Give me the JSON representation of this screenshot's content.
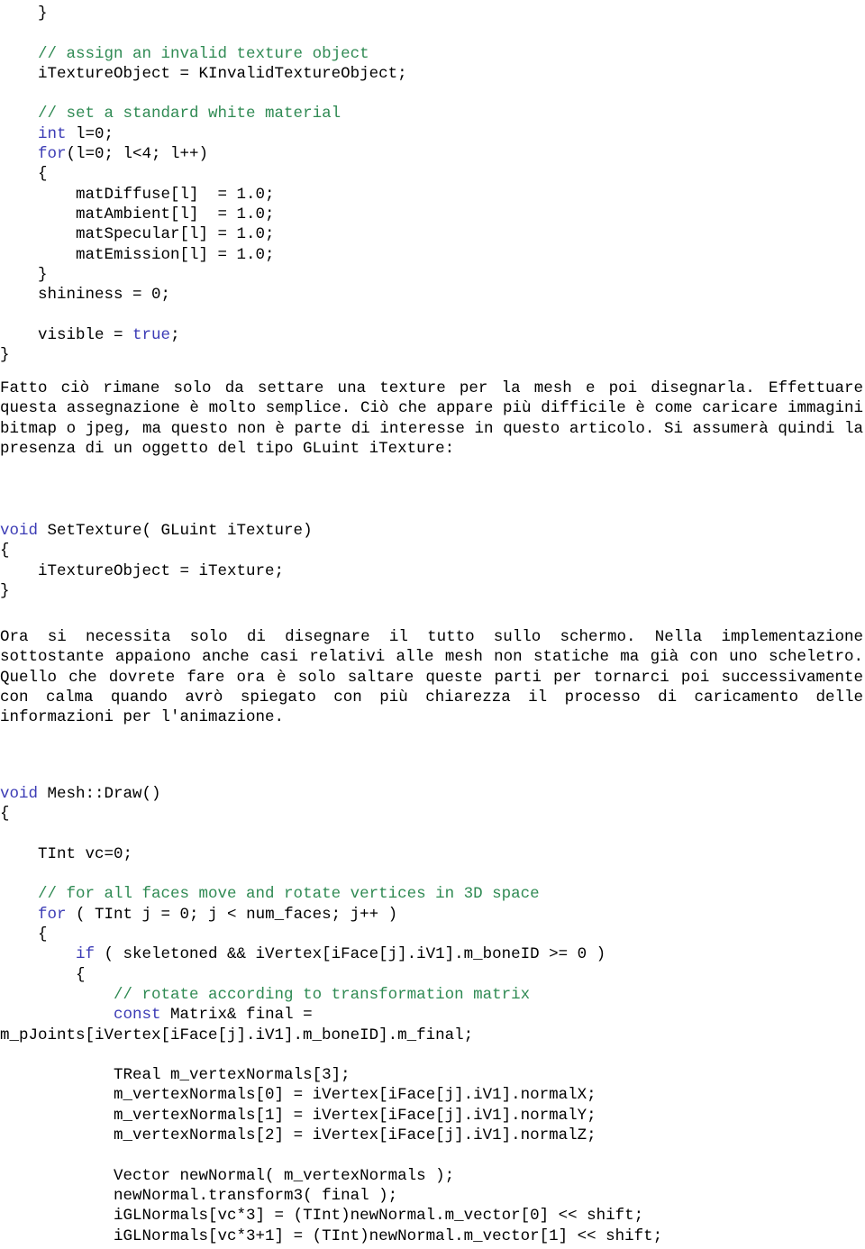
{
  "document": {
    "language": "it",
    "type": "programming-article-page",
    "background_color": "#ffffff",
    "text_color": "#000000",
    "comment_color": "#2f8a53",
    "keyword_color": "#3b3bb5"
  },
  "code_block_top": {
    "name": "mesh-constructor-tail",
    "lines": [
      {
        "indent": "    ",
        "segments": [
          {
            "style": "plain",
            "text": "}"
          }
        ]
      },
      {
        "indent": "",
        "segments": []
      },
      {
        "indent": "    ",
        "segments": [
          {
            "style": "comment",
            "text": "// assign an invalid texture object"
          }
        ]
      },
      {
        "indent": "    ",
        "segments": [
          {
            "style": "plain",
            "text": "iTextureObject = KInvalidTextureObject;"
          }
        ]
      },
      {
        "indent": "",
        "segments": []
      },
      {
        "indent": "    ",
        "segments": [
          {
            "style": "comment",
            "text": "// set a standard white material"
          }
        ]
      },
      {
        "indent": "    ",
        "segments": [
          {
            "style": "keyword",
            "text": "int"
          },
          {
            "style": "plain",
            "text": " l=0;"
          }
        ]
      },
      {
        "indent": "    ",
        "segments": [
          {
            "style": "keyword",
            "text": "for"
          },
          {
            "style": "plain",
            "text": "(l=0; l<4; l++)"
          }
        ]
      },
      {
        "indent": "    ",
        "segments": [
          {
            "style": "plain",
            "text": "{"
          }
        ]
      },
      {
        "indent": "        ",
        "segments": [
          {
            "style": "plain",
            "text": "matDiffuse[l]  = 1.0;"
          }
        ]
      },
      {
        "indent": "        ",
        "segments": [
          {
            "style": "plain",
            "text": "matAmbient[l]  = 1.0;"
          }
        ]
      },
      {
        "indent": "        ",
        "segments": [
          {
            "style": "plain",
            "text": "matSpecular[l] = 1.0;"
          }
        ]
      },
      {
        "indent": "        ",
        "segments": [
          {
            "style": "plain",
            "text": "matEmission[l] = 1.0;"
          }
        ]
      },
      {
        "indent": "    ",
        "segments": [
          {
            "style": "plain",
            "text": "}"
          }
        ]
      },
      {
        "indent": "    ",
        "segments": [
          {
            "style": "plain",
            "text": "shininess = 0;"
          }
        ]
      },
      {
        "indent": "",
        "segments": []
      },
      {
        "indent": "    ",
        "segments": [
          {
            "style": "plain",
            "text": "visible = "
          },
          {
            "style": "keyword",
            "text": "true"
          },
          {
            "style": "plain",
            "text": ";"
          }
        ]
      },
      {
        "indent": "",
        "segments": [
          {
            "style": "plain",
            "text": "}"
          }
        ]
      }
    ]
  },
  "paragraph_1": {
    "name": "texture-intro-paragraph",
    "text": "Fatto ciò rimane solo da settare una texture per la mesh e poi disegnarla. Effettuare questa assegnazione è molto semplice. Ciò che appare più difficile è come caricare immagini bitmap o jpeg, ma questo non è parte di interesse in questo articolo. Si assumerà quindi la presenza di un oggetto del tipo GLuint iTexture:"
  },
  "code_block_settexture": {
    "name": "set-texture-function",
    "lines": [
      {
        "indent": "",
        "segments": [
          {
            "style": "keyword",
            "text": "void"
          },
          {
            "style": "plain",
            "text": " SetTexture( GLuint iTexture)"
          }
        ]
      },
      {
        "indent": "",
        "segments": [
          {
            "style": "plain",
            "text": "{"
          }
        ]
      },
      {
        "indent": "    ",
        "segments": [
          {
            "style": "plain",
            "text": "iTextureObject = iTexture;"
          }
        ]
      },
      {
        "indent": "",
        "segments": [
          {
            "style": "plain",
            "text": "}"
          }
        ]
      }
    ]
  },
  "paragraph_2": {
    "name": "draw-intro-paragraph",
    "text": "Ora si necessita solo di disegnare il tutto sullo schermo. Nella implementazione sottostante appaiono anche casi relativi alle mesh non statiche ma già con uno scheletro. Quello che dovrete fare ora è solo saltare queste parti per tornarci poi successivamente con calma quando avrò spiegato con più chiarezza il processo di caricamento delle informazioni per l'animazione."
  },
  "code_block_draw": {
    "name": "mesh-draw-function",
    "lines": [
      {
        "indent": "",
        "segments": [
          {
            "style": "keyword",
            "text": "void"
          },
          {
            "style": "plain",
            "text": " Mesh::Draw()"
          }
        ]
      },
      {
        "indent": "",
        "segments": [
          {
            "style": "plain",
            "text": "{"
          }
        ]
      },
      {
        "indent": "",
        "segments": []
      },
      {
        "indent": "    ",
        "segments": [
          {
            "style": "plain",
            "text": "TInt vc=0;"
          }
        ]
      },
      {
        "indent": "",
        "segments": []
      },
      {
        "indent": "    ",
        "segments": [
          {
            "style": "comment",
            "text": "// for all faces move and rotate vertices in 3D space"
          }
        ]
      },
      {
        "indent": "    ",
        "segments": [
          {
            "style": "keyword",
            "text": "for"
          },
          {
            "style": "plain",
            "text": " ( TInt j = 0; j < num_faces; j++ )"
          }
        ]
      },
      {
        "indent": "    ",
        "segments": [
          {
            "style": "plain",
            "text": "{"
          }
        ]
      },
      {
        "indent": "        ",
        "segments": [
          {
            "style": "keyword",
            "text": "if"
          },
          {
            "style": "plain",
            "text": " ( skeletoned && iVertex[iFace[j].iV1].m_boneID >= 0 )"
          }
        ]
      },
      {
        "indent": "        ",
        "segments": [
          {
            "style": "plain",
            "text": "{"
          }
        ]
      },
      {
        "indent": "            ",
        "segments": [
          {
            "style": "comment",
            "text": "// rotate according to transformation matrix"
          }
        ]
      },
      {
        "indent": "            ",
        "segments": [
          {
            "style": "keyword",
            "text": "const"
          },
          {
            "style": "plain",
            "text": " Matrix& final ="
          }
        ]
      },
      {
        "indent": "",
        "segments": [
          {
            "style": "plain",
            "text": "m_pJoints[iVertex[iFace[j].iV1].m_boneID].m_final;"
          }
        ]
      },
      {
        "indent": "",
        "segments": []
      },
      {
        "indent": "            ",
        "segments": [
          {
            "style": "plain",
            "text": "TReal m_vertexNormals[3];"
          }
        ]
      },
      {
        "indent": "            ",
        "segments": [
          {
            "style": "plain",
            "text": "m_vertexNormals[0] = iVertex[iFace[j].iV1].normalX;"
          }
        ]
      },
      {
        "indent": "            ",
        "segments": [
          {
            "style": "plain",
            "text": "m_vertexNormals[1] = iVertex[iFace[j].iV1].normalY;"
          }
        ]
      },
      {
        "indent": "            ",
        "segments": [
          {
            "style": "plain",
            "text": "m_vertexNormals[2] = iVertex[iFace[j].iV1].normalZ;"
          }
        ]
      },
      {
        "indent": "",
        "segments": []
      },
      {
        "indent": "            ",
        "segments": [
          {
            "style": "plain",
            "text": "Vector newNormal( m_vertexNormals );"
          }
        ]
      },
      {
        "indent": "            ",
        "segments": [
          {
            "style": "plain",
            "text": "newNormal.transform3( final );"
          }
        ]
      },
      {
        "indent": "            ",
        "segments": [
          {
            "style": "plain",
            "text": "iGLNormals[vc*3] = (TInt)newNormal.m_vector[0] << shift;"
          }
        ]
      },
      {
        "indent": "            ",
        "segments": [
          {
            "style": "plain",
            "text": "iGLNormals[vc*3+1] = (TInt)newNormal.m_vector[1] << shift;"
          }
        ]
      }
    ]
  }
}
